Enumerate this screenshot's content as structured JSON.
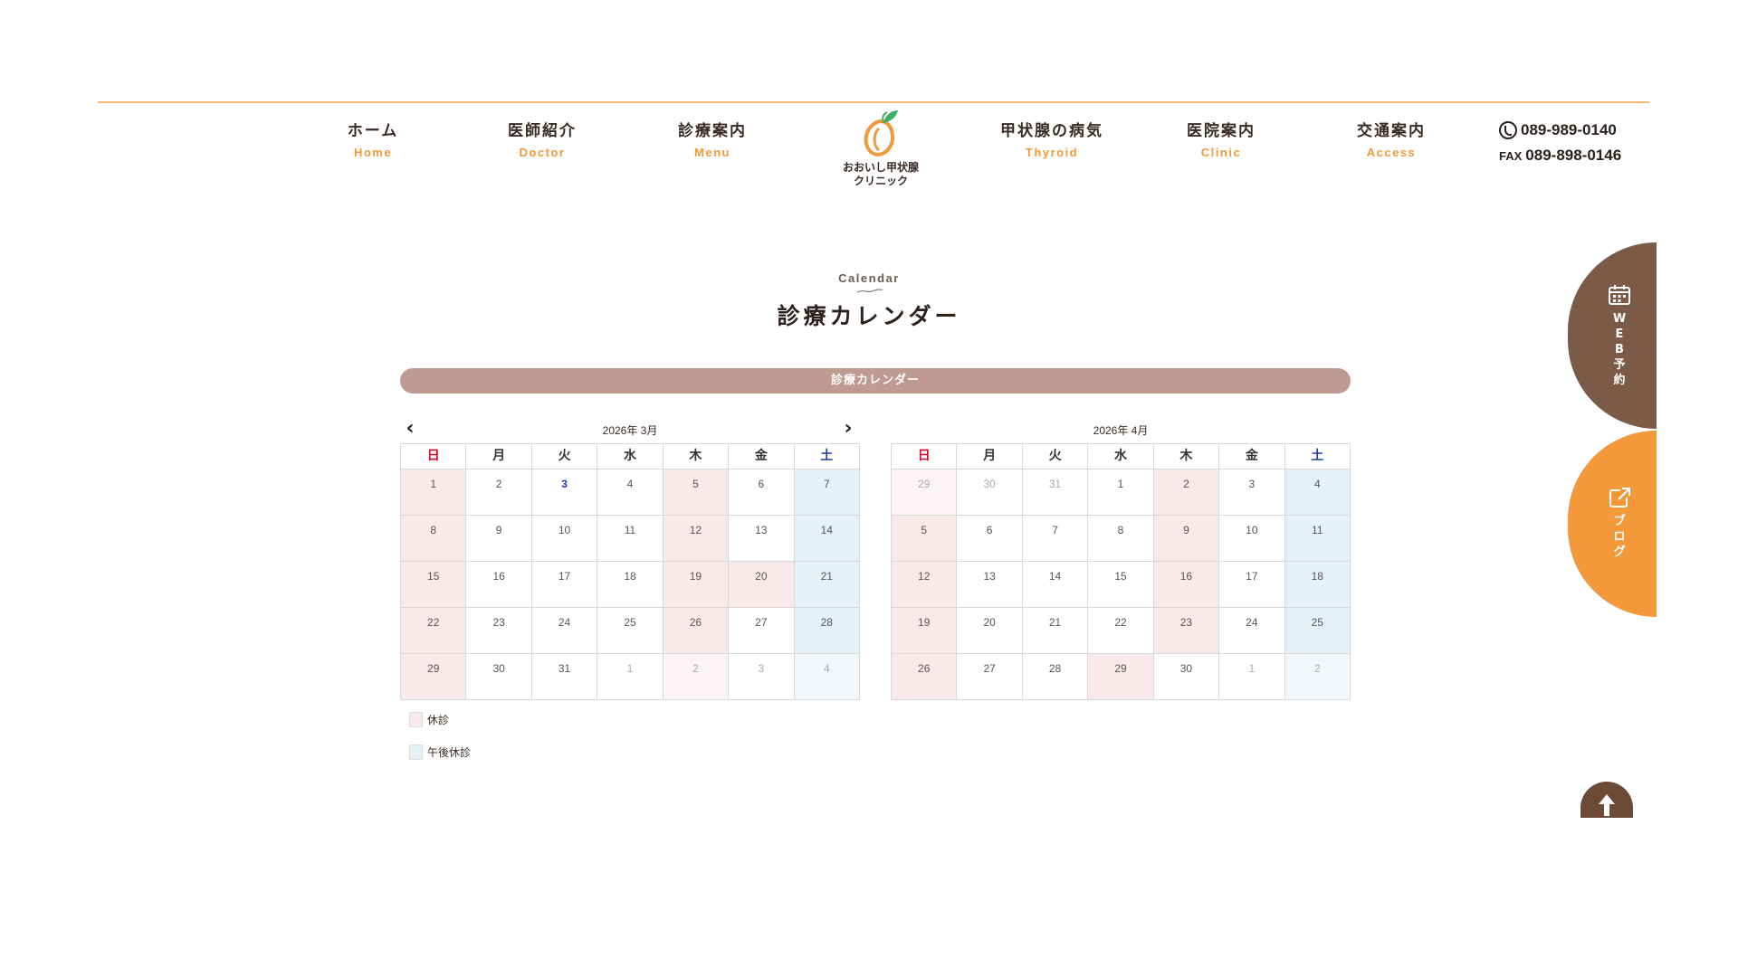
{
  "nav": {
    "items": [
      {
        "ja": "ホーム",
        "en": "Home"
      },
      {
        "ja": "医師紹介",
        "en": "Doctor"
      },
      {
        "ja": "診療案内",
        "en": "Menu"
      },
      {
        "ja": "甲状腺の病気",
        "en": "Thyroid"
      },
      {
        "ja": "医院案内",
        "en": "Clinic"
      },
      {
        "ja": "交通案内",
        "en": "Access"
      }
    ],
    "logo": {
      "line1": "おおいし甲状腺",
      "line2": "クリニック"
    },
    "contact": {
      "phone": "089-989-0140",
      "fax_label": "FAX",
      "fax": "089-898-0146"
    }
  },
  "section": {
    "en": "Calendar",
    "ja": "診療カレンダー"
  },
  "calendar": {
    "bar_label": "診療カレンダー",
    "weekdays": [
      "日",
      "月",
      "火",
      "水",
      "木",
      "金",
      "土"
    ],
    "months": [
      {
        "title": "2026年 3月",
        "days": [
          {
            "d": "1",
            "s": "closed"
          },
          {
            "d": "2"
          },
          {
            "d": "3",
            "s": "today"
          },
          {
            "d": "4"
          },
          {
            "d": "5",
            "s": "closed"
          },
          {
            "d": "6"
          },
          {
            "d": "7",
            "s": "afternoon"
          },
          {
            "d": "8",
            "s": "closed"
          },
          {
            "d": "9"
          },
          {
            "d": "10"
          },
          {
            "d": "11"
          },
          {
            "d": "12",
            "s": "closed"
          },
          {
            "d": "13"
          },
          {
            "d": "14",
            "s": "afternoon"
          },
          {
            "d": "15",
            "s": "closed"
          },
          {
            "d": "16"
          },
          {
            "d": "17"
          },
          {
            "d": "18"
          },
          {
            "d": "19",
            "s": "closed"
          },
          {
            "d": "20",
            "s": "closed"
          },
          {
            "d": "21",
            "s": "afternoon"
          },
          {
            "d": "22",
            "s": "closed"
          },
          {
            "d": "23"
          },
          {
            "d": "24"
          },
          {
            "d": "25"
          },
          {
            "d": "26",
            "s": "closed"
          },
          {
            "d": "27"
          },
          {
            "d": "28",
            "s": "afternoon"
          },
          {
            "d": "29",
            "s": "closed"
          },
          {
            "d": "30"
          },
          {
            "d": "31"
          },
          {
            "d": "1",
            "o": true
          },
          {
            "d": "2",
            "s": "closed",
            "o": true
          },
          {
            "d": "3",
            "o": true
          },
          {
            "d": "4",
            "s": "afternoon",
            "o": true
          }
        ]
      },
      {
        "title": "2026年 4月",
        "days": [
          {
            "d": "29",
            "s": "closed",
            "o": true
          },
          {
            "d": "30",
            "o": true
          },
          {
            "d": "31",
            "o": true
          },
          {
            "d": "1"
          },
          {
            "d": "2",
            "s": "closed"
          },
          {
            "d": "3"
          },
          {
            "d": "4",
            "s": "afternoon"
          },
          {
            "d": "5",
            "s": "closed"
          },
          {
            "d": "6"
          },
          {
            "d": "7"
          },
          {
            "d": "8"
          },
          {
            "d": "9",
            "s": "closed"
          },
          {
            "d": "10"
          },
          {
            "d": "11",
            "s": "afternoon"
          },
          {
            "d": "12",
            "s": "closed"
          },
          {
            "d": "13"
          },
          {
            "d": "14"
          },
          {
            "d": "15"
          },
          {
            "d": "16",
            "s": "closed"
          },
          {
            "d": "17"
          },
          {
            "d": "18",
            "s": "afternoon"
          },
          {
            "d": "19",
            "s": "closed"
          },
          {
            "d": "20"
          },
          {
            "d": "21"
          },
          {
            "d": "22"
          },
          {
            "d": "23",
            "s": "closed"
          },
          {
            "d": "24"
          },
          {
            "d": "25",
            "s": "afternoon"
          },
          {
            "d": "26",
            "s": "closed"
          },
          {
            "d": "27"
          },
          {
            "d": "28"
          },
          {
            "d": "29",
            "s": "closed"
          },
          {
            "d": "30"
          },
          {
            "d": "1",
            "o": true
          },
          {
            "d": "2",
            "s": "afternoon",
            "o": true
          }
        ]
      }
    ],
    "legend": [
      {
        "label": "休診",
        "color": "#f9e9ea"
      },
      {
        "label": "午後休診",
        "color": "#e4f1f8"
      }
    ]
  },
  "side": {
    "web_label": "WEB予約",
    "blog_label": "ブログ"
  },
  "colors": {
    "accent_orange": "#f3993a",
    "brown": "#7b5a48",
    "bar": "#bf9a91"
  }
}
